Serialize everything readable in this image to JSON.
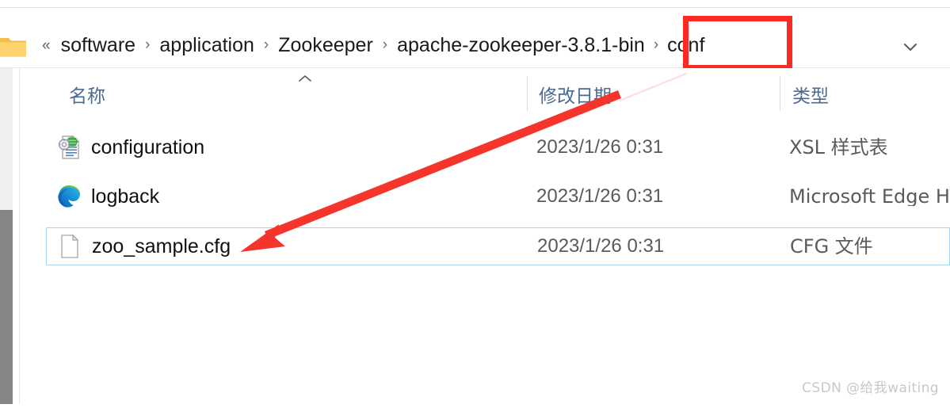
{
  "window": {
    "kind": "file-explorer"
  },
  "addressbar": {
    "folder_icon": "folder-icon",
    "overflow_label": "«",
    "separator": "›",
    "dropdown_icon": "chevron-down-icon",
    "crumbs": [
      {
        "label": "software"
      },
      {
        "label": "application"
      },
      {
        "label": "Zookeeper"
      },
      {
        "label": "apache-zookeeper-3.8.1-bin"
      },
      {
        "label": "conf"
      }
    ]
  },
  "annotations": {
    "highlight_box": {
      "target": "conf",
      "color": "#fc2b22"
    },
    "arrow": {
      "target": "zoo_sample.cfg",
      "color": "#f5342b"
    }
  },
  "columns": {
    "name": "名称",
    "date": "修改日期",
    "type": "类型",
    "sort_indicator": "sort-ascending-icon"
  },
  "files": [
    {
      "icon": "xsl-stylesheet-icon",
      "name": "configuration",
      "date": "2023/1/26 0:31",
      "type": "XSL 样式表",
      "selected": false
    },
    {
      "icon": "microsoft-edge-icon",
      "name": "logback",
      "date": "2023/1/26 0:31",
      "type": "Microsoft Edge HT...",
      "selected": false
    },
    {
      "icon": "generic-file-icon",
      "name": "zoo_sample.cfg",
      "date": "2023/1/26 0:31",
      "type": "CFG 文件",
      "selected": true
    }
  ],
  "scrollbar": {
    "orientation": "vertical",
    "position": "left"
  },
  "watermark": {
    "text": "CSDN @给我waiting"
  }
}
